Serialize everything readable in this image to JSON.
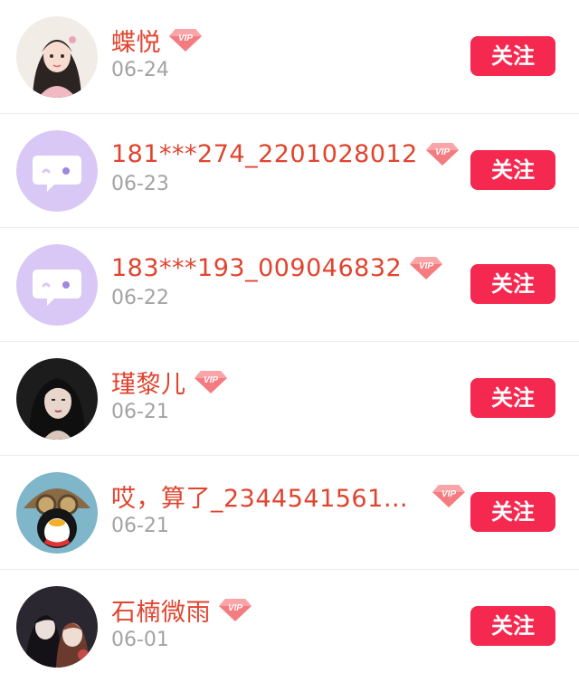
{
  "colors": {
    "username": "#e0442f",
    "date": "#a3a3a3",
    "follow_button": "#f5284f",
    "default_avatar_bg": "#d9c8f5"
  },
  "rows": [
    {
      "name": "蝶悦",
      "date": "06-24",
      "badge": "VIP",
      "button": "关注",
      "avatar": "girl-illustration-avatar"
    },
    {
      "name": "181***274_2201028012",
      "date": "06-23",
      "badge": "VIP",
      "button": "关注",
      "avatar": "default-chat-avatar"
    },
    {
      "name": "183***193_009046832",
      "date": "06-22",
      "badge": "VIP",
      "button": "关注",
      "avatar": "default-chat-avatar"
    },
    {
      "name": "瑾黎儿",
      "date": "06-21",
      "badge": "VIP",
      "button": "关注",
      "avatar": "woman-portrait-avatar"
    },
    {
      "name": "哎，算了_2344541561…",
      "date": "06-21",
      "badge": "VIP",
      "button": "关注",
      "avatar": "penguin-avatar"
    },
    {
      "name": "石楠微雨",
      "date": "06-01",
      "badge": "VIP",
      "button": "关注",
      "avatar": "anime-couple-avatar"
    }
  ]
}
